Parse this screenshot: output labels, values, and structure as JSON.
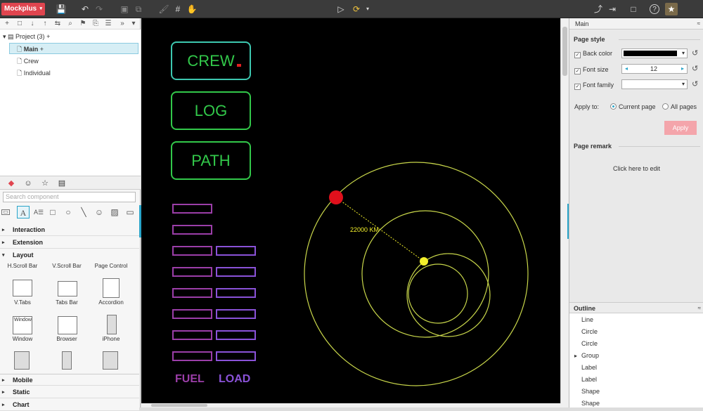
{
  "toolbar": {
    "brand": "Mockplus",
    "brand_caret": "▾",
    "save": "💾",
    "undo": "↶",
    "redo": "↷",
    "group": "▣",
    "ungroup": "⧉",
    "brush": "🖌",
    "grid": "#",
    "hand": "✋",
    "play": "▷",
    "sync": "⟳",
    "sync_caret": "▾",
    "share": "⤴",
    "export": "⇥",
    "fullscreen": "□",
    "help": "?",
    "avatar": "★"
  },
  "project": {
    "tools": [
      "+",
      "□",
      "↓",
      "↑",
      "⇆",
      "⌕",
      "⚑",
      "⎘",
      "☰",
      "»",
      "▾"
    ],
    "root": "Project (3)",
    "root_add": "+",
    "pages": [
      {
        "label": "Main",
        "add": "+"
      },
      {
        "label": "Crew"
      },
      {
        "label": "Individual"
      }
    ]
  },
  "components": {
    "tab_icons": [
      "◆",
      "☺",
      "☆",
      "▤"
    ],
    "search_placeholder": "Search component",
    "shape_icons": [
      "▭",
      "A",
      "A☰",
      "□",
      "○",
      "╲",
      "☺",
      "▨",
      "▭"
    ],
    "categories": [
      {
        "label": "Interaction",
        "tri": "▸"
      },
      {
        "label": "Extension",
        "tri": "▸"
      },
      {
        "label": "Layout",
        "tri": "▾"
      }
    ],
    "layout_items": [
      "H.Scroll Bar",
      "V.Scroll Bar",
      "Page Control",
      "V.Tabs",
      "Tabs Bar",
      "Accordion",
      "Window",
      "Browser",
      "iPhone"
    ],
    "window_caption": "Window",
    "bottom_categories": [
      {
        "label": "Mobile",
        "tri": "▸"
      },
      {
        "label": "Static",
        "tri": "▸"
      },
      {
        "label": "Chart",
        "tri": "▸"
      }
    ]
  },
  "canvas": {
    "buttons": [
      "CREW",
      "LOG",
      "PATH"
    ],
    "distance_label": "22000 KM",
    "labels": {
      "fuel": "FUEL",
      "load": "LOAD"
    },
    "colors": {
      "green": "#32c84a",
      "orbit": "#c8d64a",
      "planet": "#e0101c",
      "moon": "#f3f02b",
      "fuel": "#9b3ea8",
      "load": "#8a52d8"
    }
  },
  "properties": {
    "header": "Main",
    "page_style": "Page style",
    "back_color": {
      "label": "Back color",
      "checked": "✓",
      "value": "#000000"
    },
    "font_size": {
      "label": "Font size",
      "checked": "✓",
      "value": "12",
      "left": "◂",
      "right": "▸"
    },
    "font_family": {
      "label": "Font family",
      "checked": "✓",
      "value": ""
    },
    "reset_icon": "↺",
    "dropdown_icon": "▾",
    "apply_to": "Apply to:",
    "current_page": "Current page",
    "all_pages": "All pages",
    "apply": "Apply",
    "page_remark": "Page remark",
    "remark_hint": "Click here to edit"
  },
  "outline": {
    "title": "Outline",
    "collapse": "≈",
    "items": [
      {
        "label": "Line"
      },
      {
        "label": "Circle"
      },
      {
        "label": "Circle"
      },
      {
        "label": "Group",
        "group": true
      },
      {
        "label": "Label"
      },
      {
        "label": "Label"
      },
      {
        "label": "Shape"
      },
      {
        "label": "Shape"
      }
    ]
  }
}
